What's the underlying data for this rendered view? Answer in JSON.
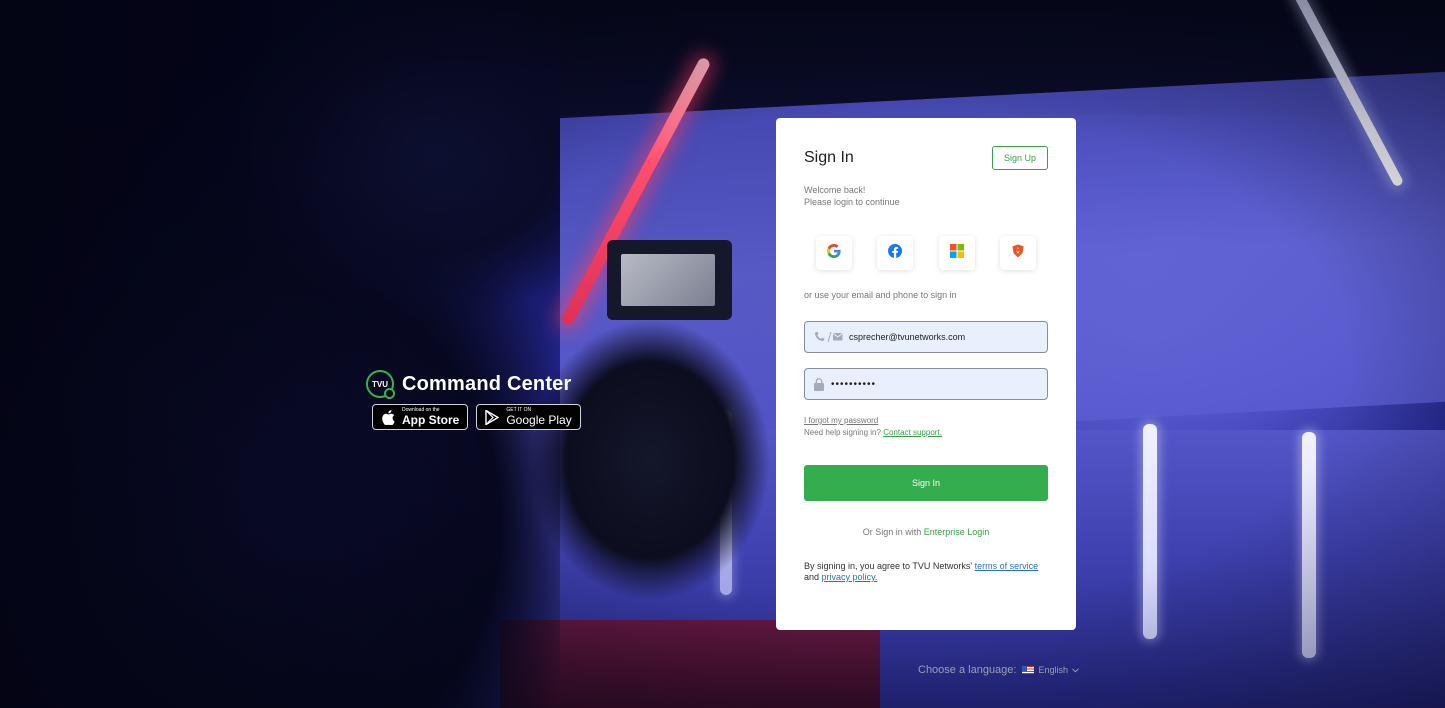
{
  "brand": {
    "logo_text": "TVU",
    "title": "Command Center",
    "app_store": {
      "small": "Download on the",
      "big": "App Store"
    },
    "google_play": {
      "small": "GET IT ON",
      "big": "Google Play"
    }
  },
  "card": {
    "title": "Sign In",
    "signup_label": "Sign Up",
    "welcome_line1": "Welcome back!",
    "welcome_line2": "Please login to continue",
    "social_providers": [
      "google",
      "facebook",
      "microsoft",
      "auth0"
    ],
    "alt_text": "or use your email and phone to sign in",
    "email_value": "csprecher@tvunetworks.com",
    "password_value": "••••••••••",
    "forgot_label": "I forgot my password",
    "help_prefix": "Need help signing in?",
    "help_link": "Contact support.",
    "signin_label": "Sign In",
    "enterprise_prefix": "Or Sign in with",
    "enterprise_link": "Enterprise Login",
    "terms_prefix": "By signing in, you agree to TVU Networks'",
    "terms_link": "terms of service",
    "terms_and": "and",
    "privacy_link": "privacy policy."
  },
  "language": {
    "label": "Choose a language:",
    "selected": "English"
  },
  "colors": {
    "accent_green": "#34ad4f",
    "link_blue": "#2a6fd1",
    "input_bg": "#e8f0fe"
  }
}
